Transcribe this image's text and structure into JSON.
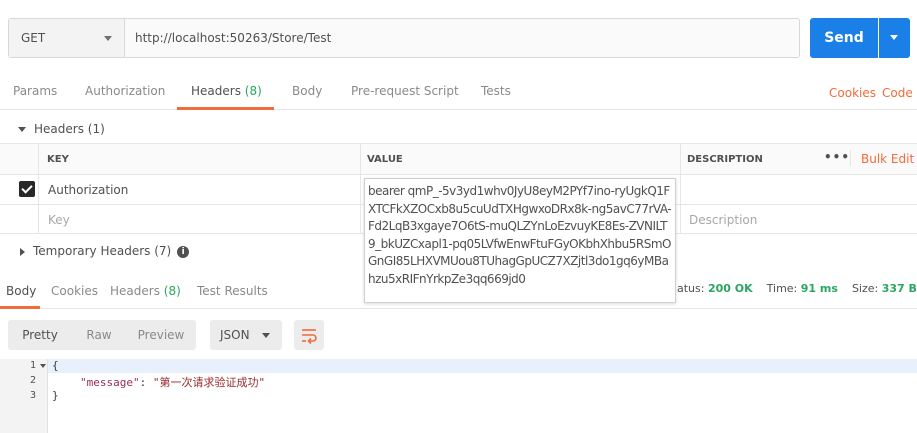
{
  "url_bar": {
    "method": "GET",
    "url": "http://localhost:50263/Store/Test",
    "send_label": "Send"
  },
  "request_tabs": {
    "params": "Params",
    "authorization": "Authorization",
    "headers": "Headers",
    "headers_count": "(8)",
    "body": "Body",
    "pre_request": "Pre-request Script",
    "tests": "Tests",
    "cookies": "Cookies",
    "code": "Code"
  },
  "headers_section": {
    "title": "Headers (1)",
    "col_key": "KEY",
    "col_value": "VALUE",
    "col_description": "DESCRIPTION",
    "bulk_edit": "Bulk Edit",
    "more": "•••",
    "row": {
      "key": "Authorization",
      "value": "bearer qmP_-5v3yd1whv0JyU8eyM2PYf7ino-ryUgkQ1FXTCFkXZOCxb8u5cuUdTXHgwxoDRx8k-ng5avC77rVA-Fd2LqB3xgaye7O6tS-muQLZYnLoEzvuyKE8Es-ZVNILT9_bkUZCxapl1-pq05LVfwEnwFtuFGyOKbhXhbu5RSmOGnGI85LHXVMUou8TUhagGpUCZ7XZjtl3do1gq6yMBahzu5xRIFnYrkpZe3qq669jd0",
      "value_start": "bearer qmP_"
    },
    "placeholder_key": "Key",
    "placeholder_description": "Description",
    "temporary_headers": "Temporary Headers (7)"
  },
  "response_tabs": {
    "body": "Body",
    "cookies": "Cookies",
    "headers": "Headers",
    "headers_count": "(8)",
    "test_results": "Test Results"
  },
  "status": {
    "status_label": "atus:",
    "status_value": "200 OK",
    "time_label": "Time:",
    "time_value": "91 ms",
    "size_label": "Size:",
    "size_value": "337 B"
  },
  "body_toolbar": {
    "pretty": "Pretty",
    "raw": "Raw",
    "preview": "Preview",
    "format": "JSON"
  },
  "code": {
    "line_numbers": [
      "1",
      "2",
      "3"
    ],
    "line1": "{",
    "line2_key": "\"message\"",
    "line2_sep": ": ",
    "line2_value": "\"第一次请求验证成功\"",
    "line3": "}"
  },
  "colors": {
    "accent": "#f26b3a",
    "send": "#1a7fe6",
    "success": "#2aa660"
  }
}
